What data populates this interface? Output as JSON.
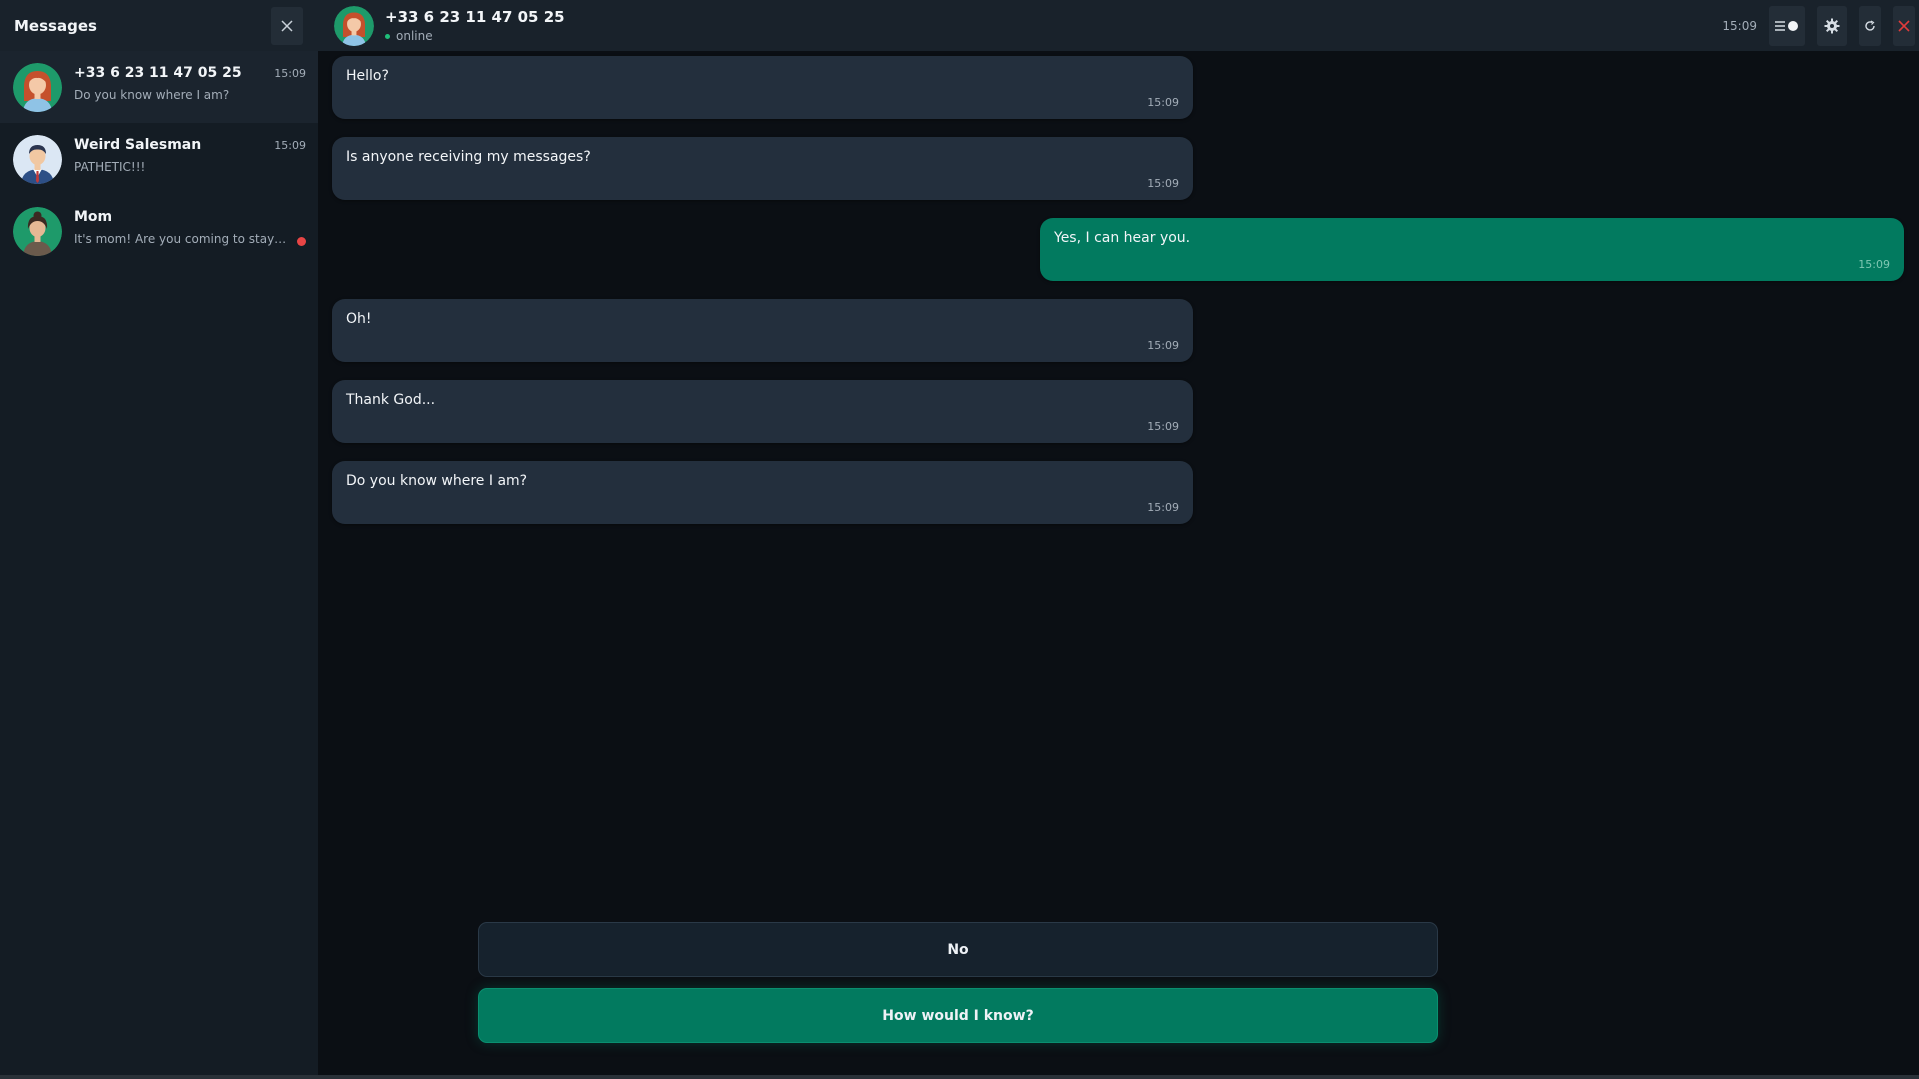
{
  "sidebar": {
    "title": "Messages",
    "conversations": [
      {
        "name": "+33 6 23 11 47 05 25",
        "time": "15:09",
        "preview": "Do you know where I am?",
        "active": true,
        "unread": false
      },
      {
        "name": "Weird Salesman",
        "time": "15:09",
        "preview": "PATHETIC!!!",
        "active": false,
        "unread": false
      },
      {
        "name": "Mom",
        "time": "",
        "preview": "It's mom! Are you coming to stay fo...",
        "active": false,
        "unread": true
      }
    ]
  },
  "chat": {
    "contact_name": "+33 6 23 11 47 05 25",
    "status": "online",
    "clock": "15:09",
    "messages": [
      {
        "text": "Hello?",
        "time": "15:09",
        "direction": "in"
      },
      {
        "text": "Is anyone receiving my messages?",
        "time": "15:09",
        "direction": "in"
      },
      {
        "text": "Yes, I can hear you.",
        "time": "15:09",
        "direction": "out"
      },
      {
        "text": "Oh!",
        "time": "15:09",
        "direction": "in"
      },
      {
        "text": "Thank God...",
        "time": "15:09",
        "direction": "in"
      },
      {
        "text": "Do you know where I am?",
        "time": "15:09",
        "direction": "in"
      }
    ],
    "choices": [
      {
        "label": "No"
      },
      {
        "label": "How would I know?"
      }
    ]
  },
  "colors": {
    "accent": "#027a5f",
    "unread": "#e84545",
    "online": "#1fbf7a",
    "close_icon": "#e03b3b"
  },
  "icons": [
    "close-icon",
    "toggle-icon",
    "gear-icon",
    "refresh-icon",
    "close-x-icon"
  ]
}
